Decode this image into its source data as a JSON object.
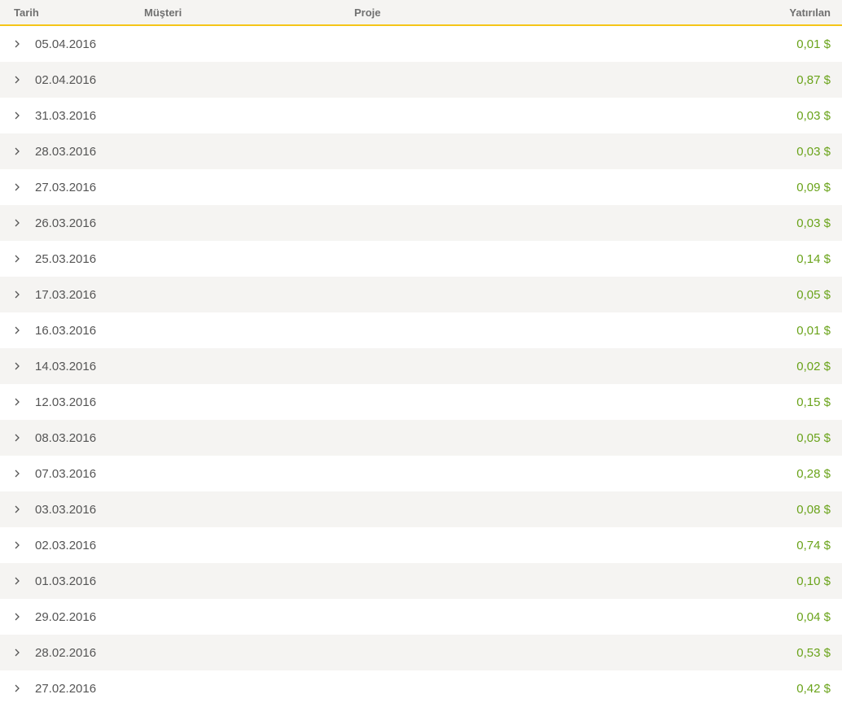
{
  "header": {
    "tarih": "Tarih",
    "musteri": "Müşteri",
    "proje": "Proje",
    "yatirilan": "Yatırılan"
  },
  "colors": {
    "amount": "#6aa31a",
    "accent_border": "#f5c518",
    "row_alt": "#f5f4f2"
  },
  "rows": [
    {
      "date": "05.04.2016",
      "amount": "0,01 $"
    },
    {
      "date": "02.04.2016",
      "amount": "0,87 $"
    },
    {
      "date": "31.03.2016",
      "amount": "0,03 $"
    },
    {
      "date": "28.03.2016",
      "amount": "0,03 $"
    },
    {
      "date": "27.03.2016",
      "amount": "0,09 $"
    },
    {
      "date": "26.03.2016",
      "amount": "0,03 $"
    },
    {
      "date": "25.03.2016",
      "amount": "0,14 $"
    },
    {
      "date": "17.03.2016",
      "amount": "0,05 $"
    },
    {
      "date": "16.03.2016",
      "amount": "0,01 $"
    },
    {
      "date": "14.03.2016",
      "amount": "0,02 $"
    },
    {
      "date": "12.03.2016",
      "amount": "0,15 $"
    },
    {
      "date": "08.03.2016",
      "amount": "0,05 $"
    },
    {
      "date": "07.03.2016",
      "amount": "0,28 $"
    },
    {
      "date": "03.03.2016",
      "amount": "0,08 $"
    },
    {
      "date": "02.03.2016",
      "amount": "0,74 $"
    },
    {
      "date": "01.03.2016",
      "amount": "0,10 $"
    },
    {
      "date": "29.02.2016",
      "amount": "0,04 $"
    },
    {
      "date": "28.02.2016",
      "amount": "0,53 $"
    },
    {
      "date": "27.02.2016",
      "amount": "0,42 $"
    }
  ]
}
